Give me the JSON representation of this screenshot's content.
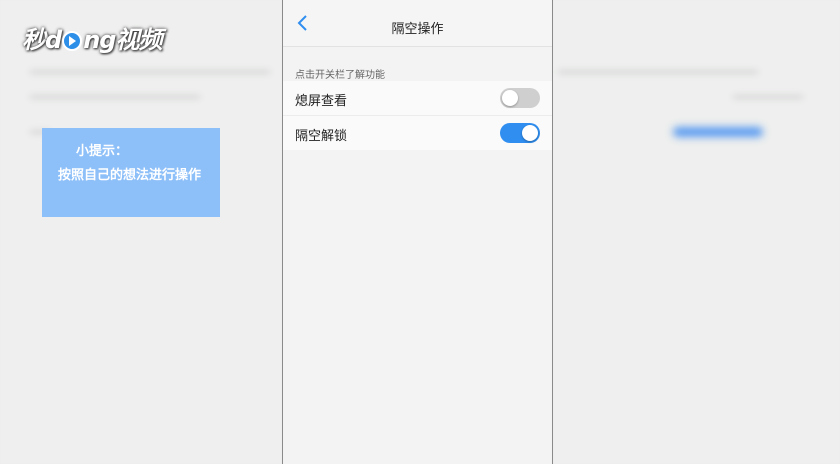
{
  "logo": {
    "part1": "秒",
    "part2": "d",
    "part3": "ng视频"
  },
  "tip": {
    "title": "小提示：",
    "body": "按照自己的想法进行操作"
  },
  "phone": {
    "nav": {
      "back_icon": "chevron-left-icon",
      "title": "隔空操作"
    },
    "hint": "点击开关栏了解功能",
    "settings": [
      {
        "label": "熄屏查看",
        "enabled": false
      },
      {
        "label": "隔空解锁",
        "enabled": true
      }
    ]
  },
  "colors": {
    "accent": "#2f8ef0",
    "toggle_off": "#cfcfcf",
    "tip_bg": "#8dbff8"
  }
}
